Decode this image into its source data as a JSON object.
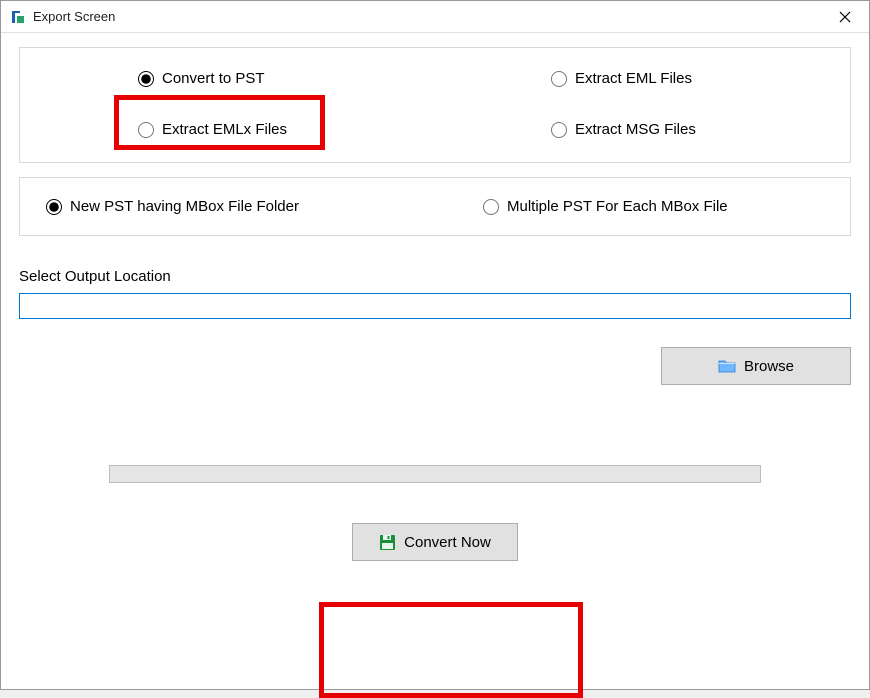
{
  "window": {
    "title": "Export Screen"
  },
  "formats": {
    "convert_pst": "Convert to PST",
    "extract_eml": "Extract EML Files",
    "extract_emlx": "Extract EMLx Files",
    "extract_msg": "Extract MSG Files"
  },
  "pst_options": {
    "new_pst": "New PST having MBox File Folder",
    "multiple_pst": "Multiple PST For Each MBox File"
  },
  "output": {
    "label": "Select Output Location",
    "value": "",
    "browse": "Browse"
  },
  "actions": {
    "convert_now": "Convert Now"
  }
}
